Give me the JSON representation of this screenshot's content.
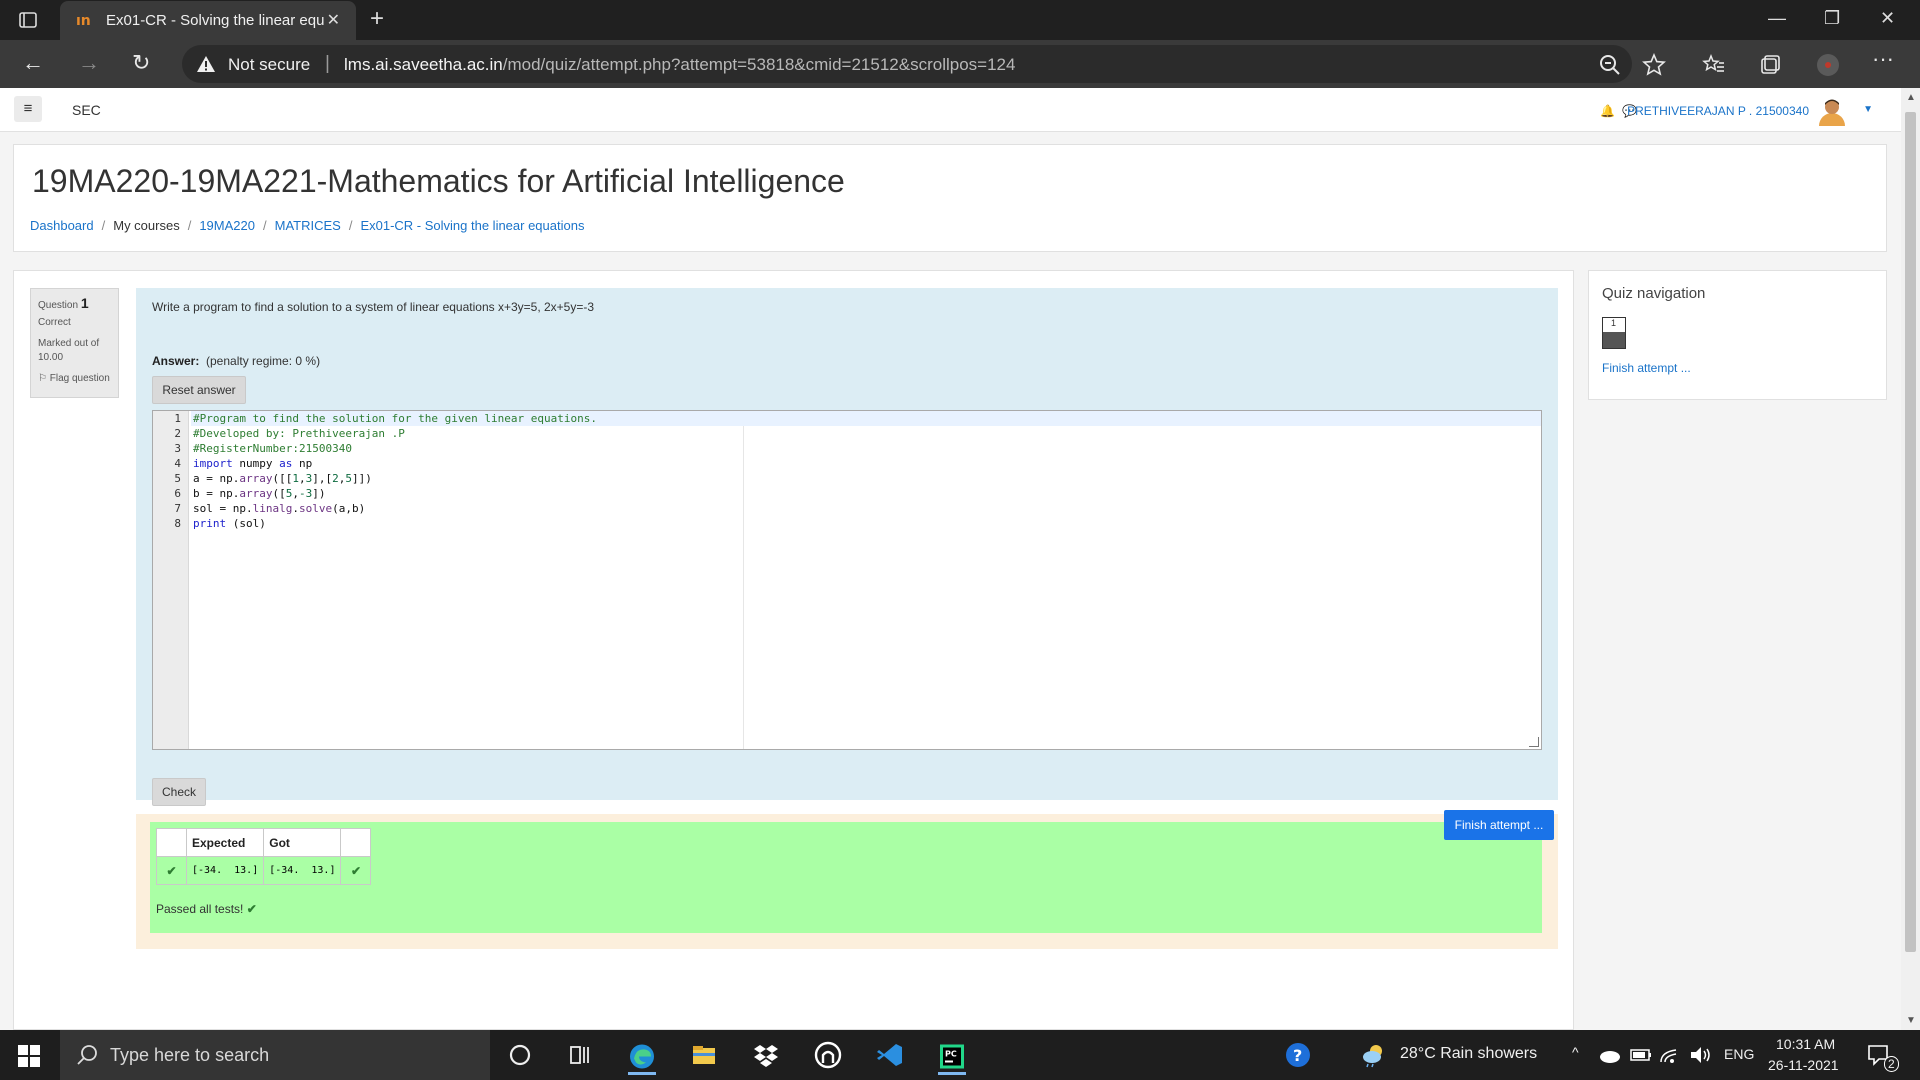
{
  "browser": {
    "tab_title": "Ex01-CR - Solving the linear equ",
    "tab_favicon": "ın",
    "security_label": "Not secure",
    "url_host": "lms.ai.saveetha.ac.in",
    "url_path": "/mod/quiz/attempt.php?attempt=53818&cmid=21512&scrollpos=124"
  },
  "topnav": {
    "site_name": "SEC",
    "user_name": "PRETHIVEERAJAN P . 21500340"
  },
  "header": {
    "course_title": "19MA220-19MA221-Mathematics for Artificial Intelligence",
    "breadcrumbs": [
      {
        "label": "Dashboard",
        "link": true
      },
      {
        "label": "My courses",
        "link": false
      },
      {
        "label": "19MA220",
        "link": true
      },
      {
        "label": "MATRICES",
        "link": true
      },
      {
        "label": "Ex01-CR - Solving the linear equations",
        "link": true
      }
    ]
  },
  "question": {
    "label": "Question",
    "number": "1",
    "status": "Correct",
    "marked": "Marked out of 10.00",
    "flag_label": "Flag question",
    "text": "Write a program to find a solution to a system of linear equations x+3y=5, 2x+5y=-3",
    "answer_label": "Answer:",
    "penalty": "(penalty regime: 0 %)",
    "reset_label": "Reset answer",
    "check_label": "Check",
    "code_lines": [
      "#Program to find the solution for the given linear equations.",
      "#Developed by: Prethiveerajan .P",
      "#RegisterNumber:21500340",
      "import numpy as np",
      "a = np.array([[1,3],[2,5]])",
      "b = np.array([5,-3])",
      "sol = np.linalg.solve(a,b)",
      "print (sol)"
    ]
  },
  "results": {
    "headers": [
      "Expected",
      "Got"
    ],
    "rows": [
      {
        "expected": "[-34.  13.]",
        "got": "[-34.  13.]"
      }
    ],
    "passed_text": "Passed all tests!"
  },
  "finish_button": "Finish attempt ...",
  "quiz_nav": {
    "title": "Quiz navigation",
    "question_number": "1",
    "finish_link": "Finish attempt ..."
  },
  "taskbar": {
    "search_placeholder": "Type here to search",
    "weather": "28°C  Rain showers",
    "language": "ENG",
    "time": "10:31 AM",
    "date": "26-11-2021",
    "notification_count": "2"
  },
  "colors": {
    "accent": "#1a73e8",
    "link": "#1a73c9",
    "question_bg": "#dcedf4",
    "pass_bg": "#aaffa5",
    "outcome_bg": "#fcefdc"
  }
}
